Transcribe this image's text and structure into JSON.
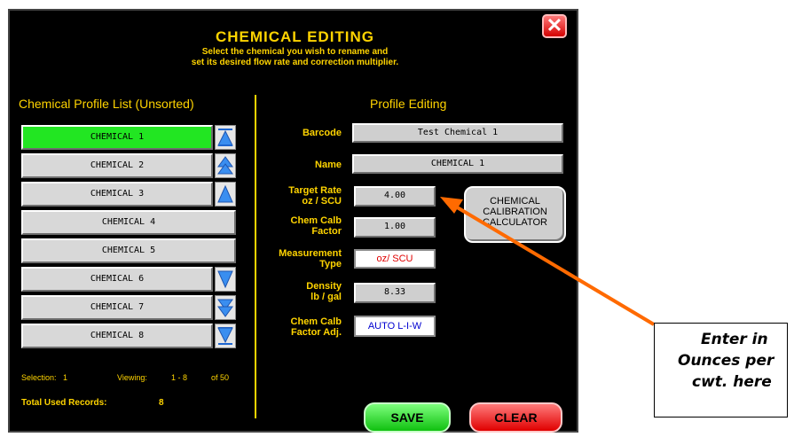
{
  "dialog": {
    "title": "CHEMICAL EDITING",
    "subtitle_line1": "Select the chemical you wish to rename and",
    "subtitle_line2": "set its desired flow rate and correction multiplier.",
    "close_label": "✕"
  },
  "list": {
    "heading": "Chemical Profile List (Unsorted)",
    "items": [
      {
        "label": "CHEMICAL 1",
        "selected": true
      },
      {
        "label": "CHEMICAL 2",
        "selected": false
      },
      {
        "label": "CHEMICAL 3",
        "selected": false
      },
      {
        "label": "CHEMICAL 4",
        "selected": false
      },
      {
        "label": "CHEMICAL 5",
        "selected": false
      },
      {
        "label": "CHEMICAL 6",
        "selected": false
      },
      {
        "label": "CHEMICAL 7",
        "selected": false
      },
      {
        "label": "CHEMICAL 8",
        "selected": false
      }
    ],
    "scroll_icons": [
      "jump-top-icon",
      "page-up-icon",
      "up-icon",
      "down-icon",
      "page-down-icon",
      "jump-bottom-icon"
    ],
    "status": {
      "selection_label": "Selection:",
      "selection_value": "1",
      "viewing_label": "Viewing:",
      "viewing_range": "1 - 8",
      "viewing_total": "of 50",
      "total_label": "Total Used Records:",
      "total_value": "8"
    }
  },
  "profile": {
    "heading": "Profile Editing",
    "barcode_label": "Barcode",
    "barcode_value": "Test Chemical 1",
    "name_label": "Name",
    "name_value": "CHEMICAL 1",
    "target_label_1": "Target Rate",
    "target_label_2": "oz / SCU",
    "target_value": "4.00",
    "calb_label_1": "Chem Calb",
    "calb_label_2": "Factor",
    "calb_value": "1.00",
    "meas_label_1": "Measurement",
    "meas_label_2": "Type",
    "meas_value": "oz/ SCU",
    "density_label_1": "Density",
    "density_label_2": "lb / gal",
    "density_value": "8.33",
    "adj_label_1": "Chem Calb",
    "adj_label_2": "Factor Adj.",
    "adj_value": "AUTO L-I-W",
    "calc_line1": "CHEMICAL",
    "calc_line2": "CALIBRATION",
    "calc_line3": "CALCULATOR",
    "save_label": "SAVE",
    "clear_label": "CLEAR"
  },
  "annotation": {
    "line1": "Enter in",
    "line2": "Ounces per",
    "line3": "cwt. here",
    "arrow_color": "#ff6a00"
  },
  "colors": {
    "accent": "#ffd400",
    "selected": "#22e622",
    "measurement_text": "#e00000",
    "adjust_text": "#0000d0"
  }
}
